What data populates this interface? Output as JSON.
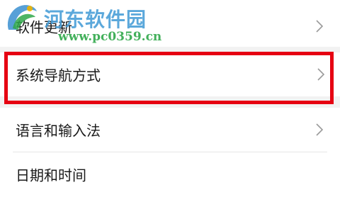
{
  "settings": {
    "items": [
      {
        "label": "软件更新"
      },
      {
        "label": "系统导航方式"
      },
      {
        "label": "语言和输入法"
      },
      {
        "label": "日期和时间"
      }
    ]
  },
  "watermark": {
    "title": "河东软件园",
    "url": "www.pc0359.cn"
  },
  "colors": {
    "highlight": "#e60012",
    "watermark_title": "#4a9fd8",
    "watermark_url": "#2fa84a"
  }
}
